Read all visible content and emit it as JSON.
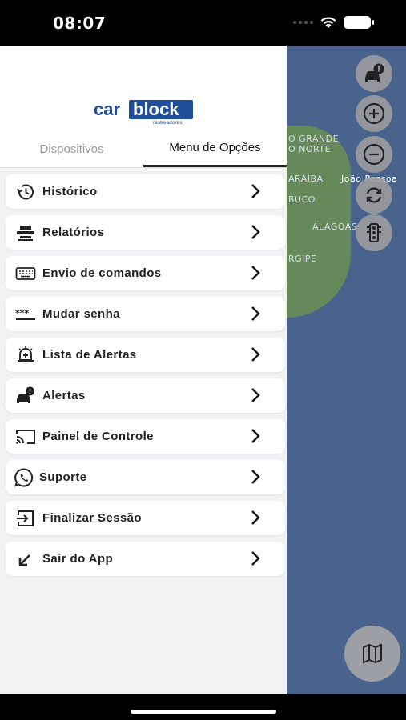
{
  "status_bar": {
    "time": "08:07"
  },
  "logo": {
    "text_part1": "car",
    "text_part2": "block",
    "subtitle": "rastreadores"
  },
  "tabs": [
    {
      "label": "Dispositivos",
      "active": false
    },
    {
      "label": "Menu de Opções",
      "active": true
    }
  ],
  "menu": {
    "items": [
      {
        "label": "Histórico",
        "icon": "history-icon"
      },
      {
        "label": "Relatórios",
        "icon": "reports-icon"
      },
      {
        "label": "Envio de comandos",
        "icon": "keyboard-icon"
      },
      {
        "label": "Mudar senha",
        "icon": "password-icon"
      },
      {
        "label": "Lista de Alertas",
        "icon": "alert-list-icon"
      },
      {
        "label": "Alertas",
        "icon": "car-alert-icon"
      },
      {
        "label": "Painel de Controle",
        "icon": "cast-icon"
      },
      {
        "label": "Suporte",
        "icon": "whatsapp-icon"
      },
      {
        "label": "Finalizar Sessão",
        "icon": "logout-icon"
      },
      {
        "label": "Sair do App",
        "icon": "exit-arrow-icon"
      }
    ]
  },
  "map": {
    "labels": [
      "O GRANDE",
      "O NORTE",
      "ARAÍBA",
      "João Pessoa",
      "BUCO",
      "ALAGOAS",
      "RGIPE"
    ]
  },
  "colors": {
    "map_water": "#4a638d",
    "land": "#6b8f52",
    "drawer_bg": "#f2f2f4",
    "logo_blue": "#1f4f9a"
  }
}
